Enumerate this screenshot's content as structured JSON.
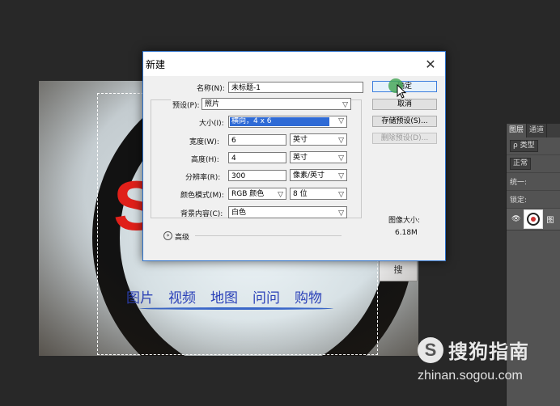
{
  "photo": {
    "logo_glyph": "S",
    "search_btn": "搜",
    "links": [
      "图片",
      "视频",
      "地图",
      "问问",
      "购物"
    ]
  },
  "layers_panel": {
    "tabs": [
      "图层",
      "通道"
    ],
    "filter_label": "ρ 类型",
    "blend_mode": "正常",
    "unify_label": "统一:",
    "lock_label": "锁定:",
    "layer_name": "图"
  },
  "dialog": {
    "title": "新建",
    "close_glyph": "✕",
    "name_label": "名称(N):",
    "name_value": "未标题-1",
    "preset_label": "预设(P):",
    "preset_value": "照片",
    "size_label": "大小(I):",
    "size_value": "横向，4 x 6",
    "width_label": "宽度(W):",
    "width_value": "6",
    "width_unit": "英寸",
    "height_label": "高度(H):",
    "height_value": "4",
    "height_unit": "英寸",
    "resolution_label": "分辨率(R):",
    "resolution_value": "300",
    "resolution_unit": "像素/英寸",
    "color_mode_label": "颜色模式(M):",
    "color_mode_value": "RGB 颜色",
    "bit_depth_value": "8 位",
    "background_label": "背景内容(C):",
    "background_value": "白色",
    "advanced_label": "高级",
    "image_size_label": "图像大小:",
    "image_size_value": "6.18M",
    "buttons": {
      "ok": "确定",
      "cancel": "取消",
      "save_preset": "存储预设(S)...",
      "delete_preset": "删除预设(D)..."
    }
  },
  "watermark": {
    "logo": "S",
    "brand": "搜狗指南",
    "url": "zhinan.sogou.com"
  }
}
